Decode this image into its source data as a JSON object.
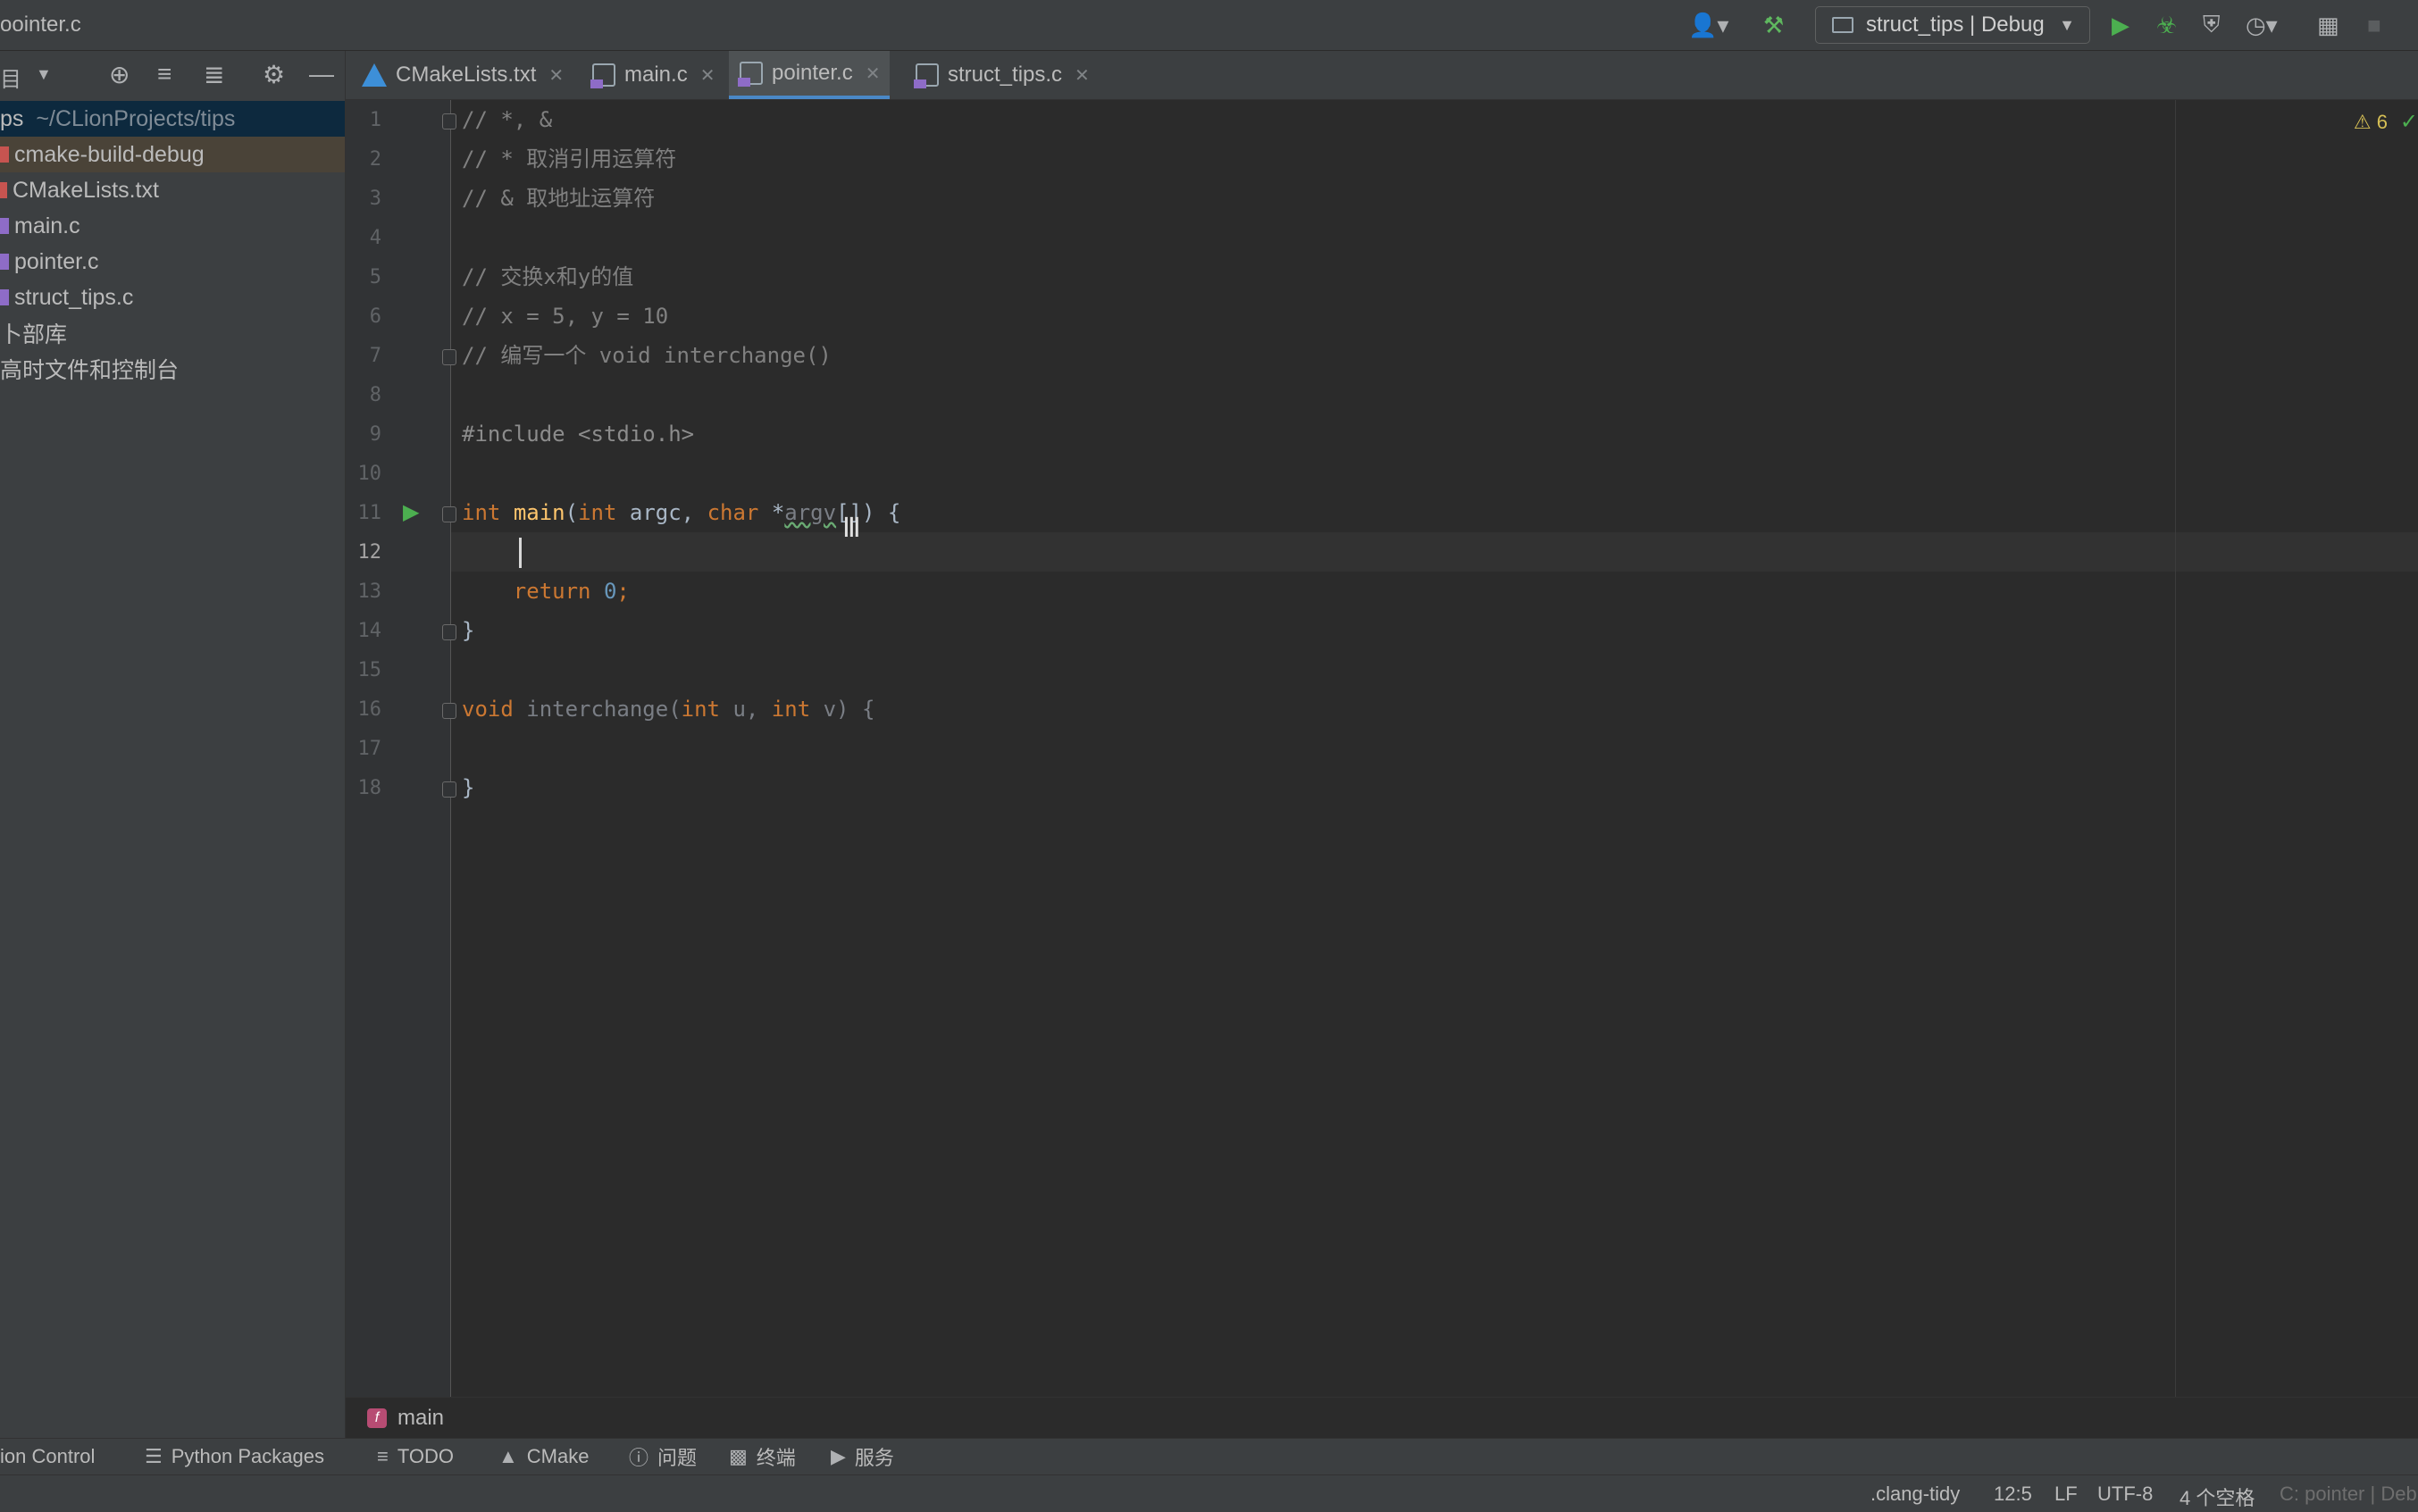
{
  "window": {
    "title": "oointer.c"
  },
  "toolbar": {
    "run_config_label": "struct_tips | Debug",
    "icons": [
      "account-icon",
      "build-hammer-icon",
      "run-icon",
      "debug-icon",
      "coverage-icon",
      "profiler-icon",
      "attach-icon",
      "stop-icon"
    ]
  },
  "sidebar": {
    "header_label": "目",
    "project_root_name": "ps",
    "project_root_path": "~/CLionProjects/tips",
    "items": [
      {
        "label": "cmake-build-debug",
        "type": "folder"
      },
      {
        "label": "CMakeLists.txt",
        "type": "cmake"
      },
      {
        "label": "main.c",
        "type": "c"
      },
      {
        "label": "pointer.c",
        "type": "c"
      },
      {
        "label": "struct_tips.c",
        "type": "c"
      },
      {
        "label": "卜部库",
        "type": "libraries"
      },
      {
        "label": "高时文件和控制台",
        "type": "scratches"
      }
    ]
  },
  "tabs": [
    {
      "label": "CMakeLists.txt",
      "active": false
    },
    {
      "label": "main.c",
      "active": false
    },
    {
      "label": "pointer.c",
      "active": true
    },
    {
      "label": "struct_tips.c",
      "active": false
    }
  ],
  "editor": {
    "warnings_count": "6",
    "current_line": 12,
    "line_numbers": [
      "1",
      "2",
      "3",
      "4",
      "5",
      "6",
      "7",
      "8",
      "9",
      "10",
      "11",
      "12",
      "13",
      "14",
      "15",
      "16",
      "17",
      "18"
    ],
    "lines": {
      "l1": "// *, &",
      "l2": "// * 取消引用运算符",
      "l3": "// & 取地址运算符",
      "l5": "// 交换x和y的值",
      "l6": "// x = 5, y = 10",
      "l7": "// 编写一个 void interchange()",
      "l9": "#include <stdio.h>",
      "l11": {
        "kw1": "int",
        "fn": "main",
        "p1": "(",
        "kw2": "int",
        "p2": " argc, ",
        "kw3": "char",
        "p3": " *",
        "unused": "argv",
        "p4": "[]) {"
      },
      "l13": {
        "kw": "return",
        "num": "0",
        "end": ";"
      },
      "l14": "}",
      "l16": {
        "kw1": "void",
        "fn": " interchange(",
        "kw2": "int",
        "p1": " u, ",
        "kw3": "int",
        "p2": " v) {"
      },
      "l18": "}"
    }
  },
  "breadcrumb": {
    "label": "main"
  },
  "tool_windows": [
    {
      "label": "ion Control",
      "icon": "version-control-icon"
    },
    {
      "label": "Python Packages",
      "icon": "layers-icon"
    },
    {
      "label": "TODO",
      "icon": "list-icon"
    },
    {
      "label": "CMake",
      "icon": "cmake-icon"
    },
    {
      "label": "问题",
      "icon": "problems-icon"
    },
    {
      "label": "终端",
      "icon": "terminal-icon"
    },
    {
      "label": "服务",
      "icon": "services-icon"
    }
  ],
  "status": {
    "linter": ".clang-tidy",
    "position": "12:5",
    "line_ending": "LF",
    "encoding": "UTF-8",
    "indent": "4 个空格",
    "context": "C: pointer | Deb"
  },
  "colors": {
    "accent": "#4a88c7",
    "keyword": "#cc7832",
    "function": "#ffc66d",
    "comment": "#808080",
    "number": "#6897bb",
    "run_green": "#4caf50"
  }
}
